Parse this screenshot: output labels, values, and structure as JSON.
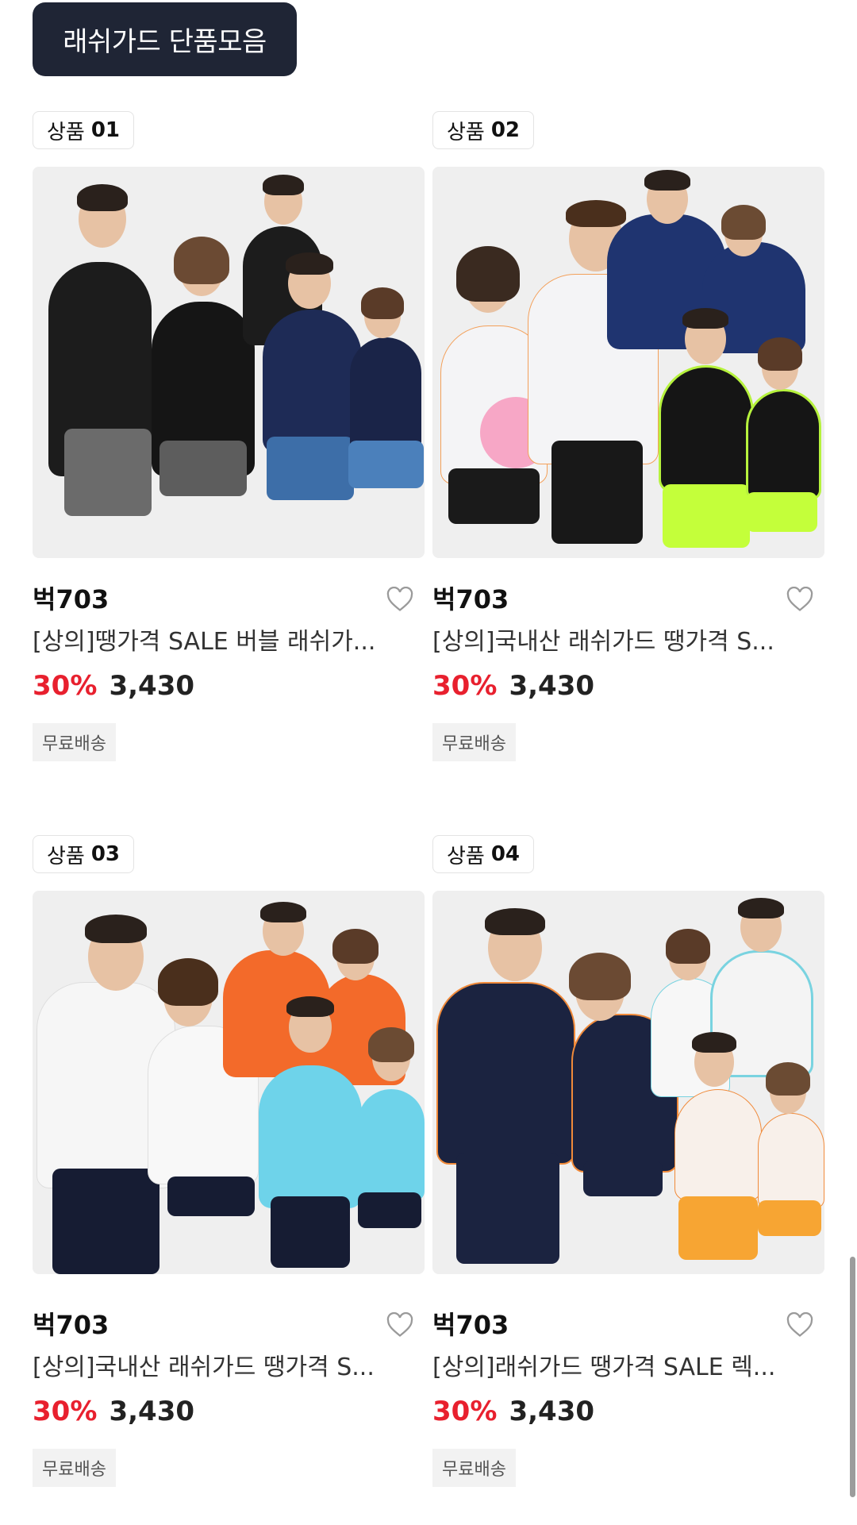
{
  "section": {
    "title": "래쉬가드 단품모음"
  },
  "products": [
    {
      "rank_label": "상품",
      "rank_num": "01",
      "brand": "벅703",
      "name": "[상의]땡가격 SALE 버블 래쉬가...",
      "discount": "30%",
      "price": "3,430",
      "tag": "무료배송"
    },
    {
      "rank_label": "상품",
      "rank_num": "02",
      "brand": "벅703",
      "name": "[상의]국내산 래쉬가드 땡가격 S...",
      "discount": "30%",
      "price": "3,430",
      "tag": "무료배송"
    },
    {
      "rank_label": "상품",
      "rank_num": "03",
      "brand": "벅703",
      "name": "[상의]국내산 래쉬가드 땡가격 S...",
      "discount": "30%",
      "price": "3,430",
      "tag": "무료배송"
    },
    {
      "rank_label": "상품",
      "rank_num": "04",
      "brand": "벅703",
      "name": "[상의]래쉬가드 땡가격 SALE 렉...",
      "discount": "30%",
      "price": "3,430",
      "tag": "무료배송"
    }
  ],
  "colors": {
    "header_bg": "#1f2535",
    "discount": "#e8202e",
    "tag_bg": "#f2f2f2"
  },
  "icons": {
    "wishlist": "heart-outline-icon"
  }
}
